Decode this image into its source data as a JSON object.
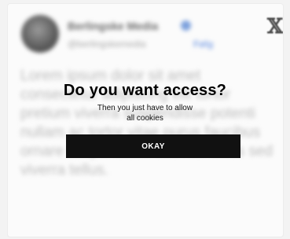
{
  "post": {
    "account_name": "Berlingske Media",
    "handle": "@berlingskemedia",
    "follow_label": "Følg",
    "text": "Lorem ipsum dolor sit amet consectetur adipiscing elit tortor pretium viverra suspendisse potenti nullam ac tortor vitae purus faucibus ornare suspendisse sed nisi lacus sed viverra tellus."
  },
  "consent": {
    "headline": "Do you want access?",
    "subtext_line1": "Then you just have to allow",
    "subtext_line2": "all cookies",
    "button_label": "OKAY"
  },
  "icons": {
    "platform_logo": "x-logo-icon",
    "verified": "verified-badge-icon"
  },
  "colors": {
    "button_bg": "#111111",
    "button_text": "#ffffff",
    "background": "#f3f3f3"
  }
}
